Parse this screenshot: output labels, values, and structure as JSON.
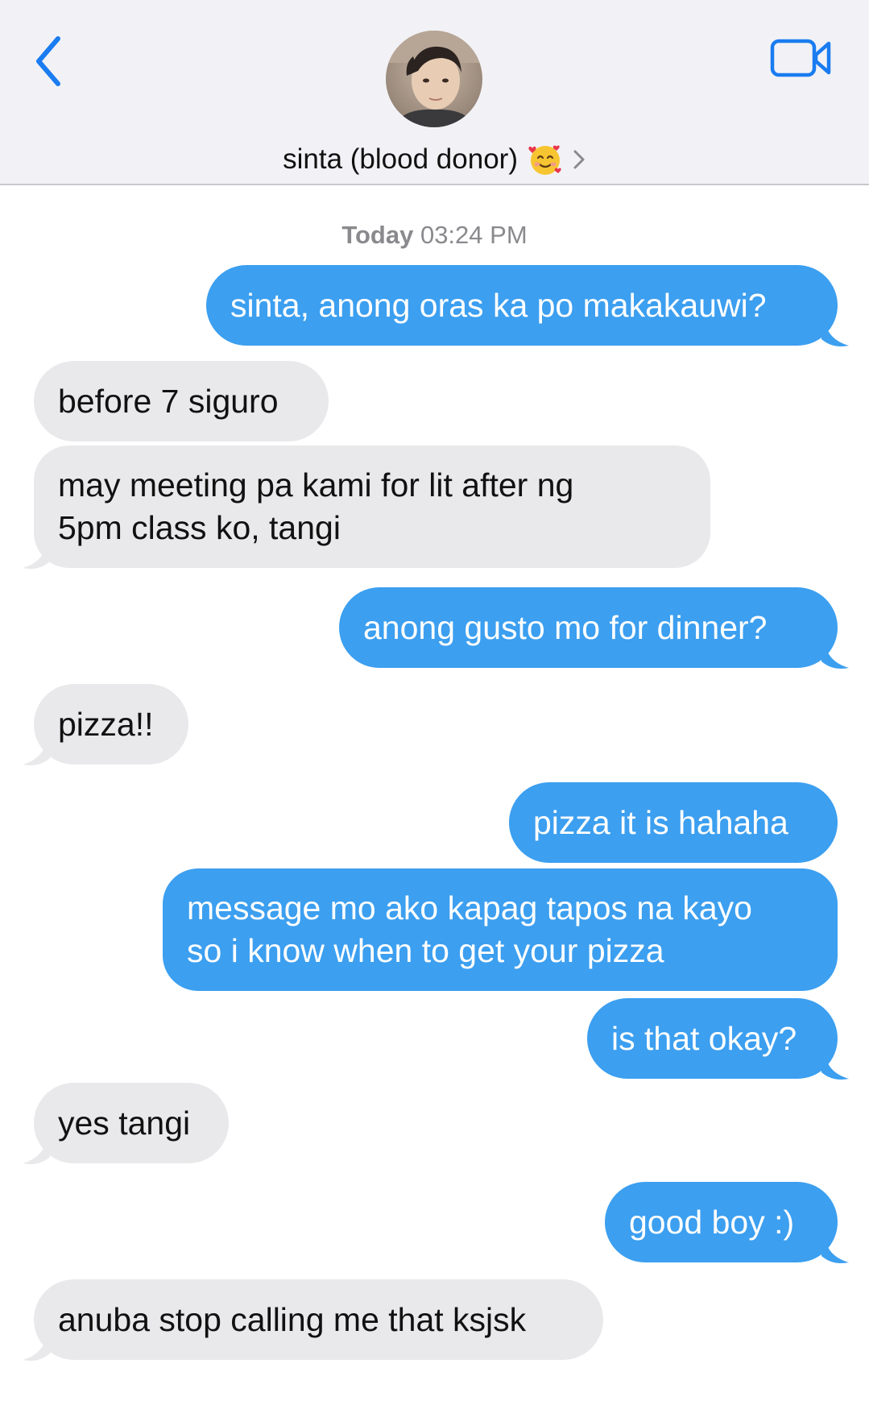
{
  "header": {
    "back_icon": "chevron-left-icon",
    "video_icon": "video-camera-icon",
    "contact_name": "sinta (blood donor)",
    "emoji_icon": "smiling-face-with-hearts-icon",
    "accent_color": "#1a7cf0"
  },
  "timestamp": {
    "day": "Today",
    "time": "03:24 PM"
  },
  "colors": {
    "sent_bubble": "#3c9ff0",
    "received_bubble": "#e9e9eb"
  },
  "messages": [
    {
      "from": "me",
      "text": "sinta, anong oras ka po makakauwi?"
    },
    {
      "from": "them",
      "text": "before 7 siguro"
    },
    {
      "from": "them",
      "text": "may meeting pa kami for lit after ng\n5pm class ko, tangi"
    },
    {
      "from": "me",
      "text": "anong gusto mo for dinner?"
    },
    {
      "from": "them",
      "text": "pizza!!"
    },
    {
      "from": "me",
      "text": "pizza it is hahaha"
    },
    {
      "from": "me",
      "text": "message mo ako kapag tapos na kayo\nso i know when to get your pizza"
    },
    {
      "from": "me",
      "text": "is that okay?"
    },
    {
      "from": "them",
      "text": "yes tangi"
    },
    {
      "from": "me",
      "text": "good boy :)"
    },
    {
      "from": "them",
      "text": "anuba stop calling me that ksjsk"
    }
  ]
}
